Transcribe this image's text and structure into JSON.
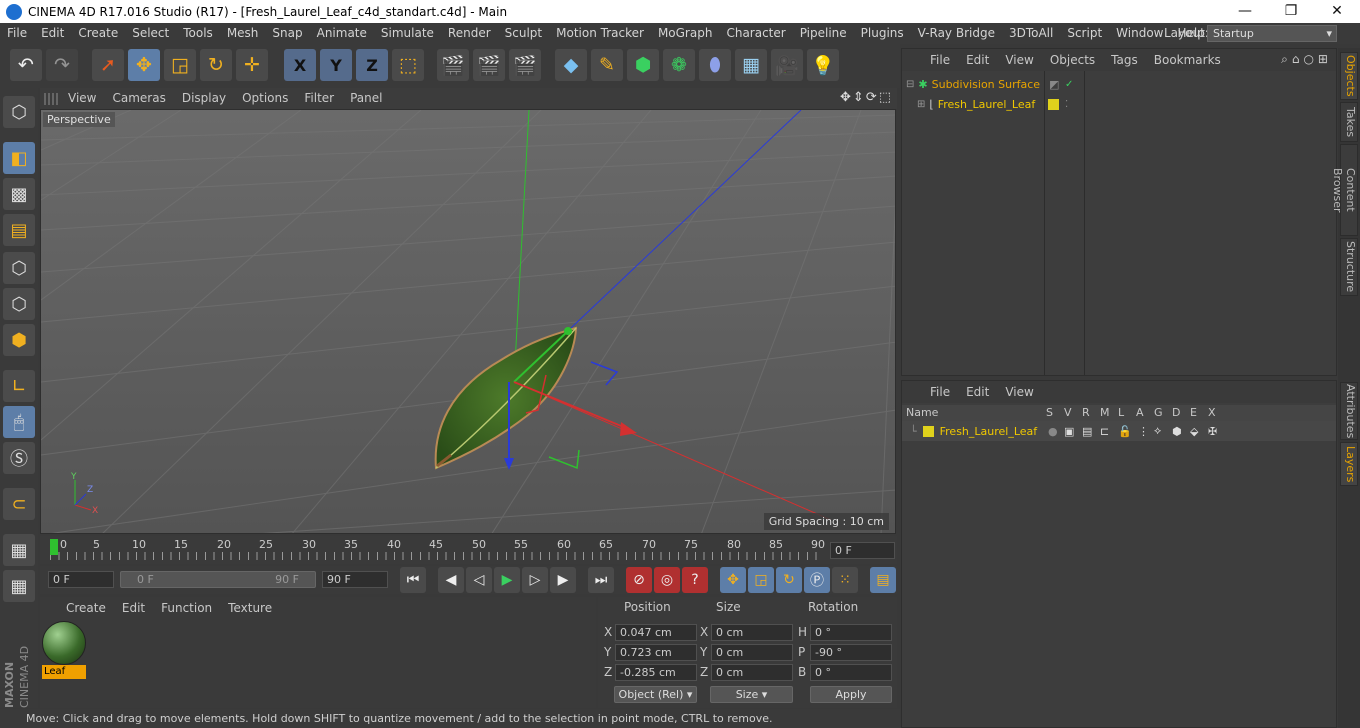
{
  "window": {
    "title": "CINEMA 4D R17.016 Studio (R17) - [Fresh_Laurel_Leaf_c4d_standart.c4d] - Main",
    "minimize": "—",
    "maximize": "❐",
    "close": "✕"
  },
  "menubar": {
    "items": [
      "File",
      "Edit",
      "Create",
      "Select",
      "Tools",
      "Mesh",
      "Snap",
      "Animate",
      "Simulate",
      "Render",
      "Sculpt",
      "Motion Tracker",
      "MoGraph",
      "Character",
      "Pipeline",
      "Plugins",
      "V-Ray Bridge",
      "3DToAll",
      "Script",
      "Window",
      "Help"
    ],
    "layout_label": "Layout:",
    "layout_value": "Startup"
  },
  "toolbar": {
    "axis_x": "X",
    "axis_y": "Y",
    "axis_z": "Z"
  },
  "viewport": {
    "menu": [
      "View",
      "Cameras",
      "Display",
      "Options",
      "Filter",
      "Panel"
    ],
    "camera_label": "Perspective",
    "grid_spacing": "Grid Spacing : 10 cm",
    "axis_x": "X",
    "axis_y": "Y",
    "axis_z": "Z",
    "accent_green": "#2fc02f",
    "accent_blue": "#2a3bd8",
    "accent_red": "#d43030"
  },
  "timeline": {
    "ticks": [
      "0",
      "5",
      "10",
      "15",
      "20",
      "25",
      "30",
      "35",
      "40",
      "45",
      "50",
      "55",
      "60",
      "65",
      "70",
      "75",
      "80",
      "85",
      "90"
    ],
    "current_frame": "0 F"
  },
  "playback": {
    "start_field": "0 F",
    "range_start": "0 F",
    "range_end": "90 F",
    "end_field": "90 F"
  },
  "material_panel": {
    "menu": [
      "Create",
      "Edit",
      "Function",
      "Texture"
    ],
    "materials": [
      {
        "name": "Leaf"
      }
    ]
  },
  "coordinates": {
    "headers": {
      "position": "Position",
      "size": "Size",
      "rotation": "Rotation"
    },
    "rows": [
      {
        "axis": "X",
        "position": "0.047 cm",
        "size_axis": "X",
        "size": "0 cm",
        "rot_axis": "H",
        "rotation": "0 °"
      },
      {
        "axis": "Y",
        "position": "0.723 cm",
        "size_axis": "Y",
        "size": "0 cm",
        "rot_axis": "P",
        "rotation": "-90 °"
      },
      {
        "axis": "Z",
        "position": "-0.285 cm",
        "size_axis": "Z",
        "size": "0 cm",
        "rot_axis": "B",
        "rotation": "0 °"
      }
    ],
    "mode_select": "Object (Rel)",
    "size_select": "Size",
    "apply_button": "Apply"
  },
  "object_manager": {
    "menu": [
      "File",
      "Edit",
      "View",
      "Objects",
      "Tags",
      "Bookmarks"
    ],
    "objects": [
      {
        "name": "Subdivision Surface",
        "color": "#e8a400"
      },
      {
        "name": "Fresh_Laurel_Leaf",
        "color": "#f0c800"
      }
    ]
  },
  "layer_manager": {
    "menu": [
      "File",
      "Edit",
      "View"
    ],
    "columns": [
      "Name",
      "S",
      "V",
      "R",
      "M",
      "L",
      "A",
      "G",
      "D",
      "E",
      "X"
    ],
    "layers": [
      {
        "name": "Fresh_Laurel_Leaf"
      }
    ]
  },
  "right_tabs": {
    "objects": "Objects",
    "takes": "Takes",
    "content_browser": "Content Browser",
    "structure": "Structure",
    "attributes": "Attributes",
    "layers": "Layers"
  },
  "status": {
    "text": "Move: Click and drag to move elements. Hold down SHIFT to quantize movement / add to the selection in point mode, CTRL to remove."
  },
  "branding": {
    "maxon": "MAXON",
    "cinema": "CINEMA 4D"
  }
}
